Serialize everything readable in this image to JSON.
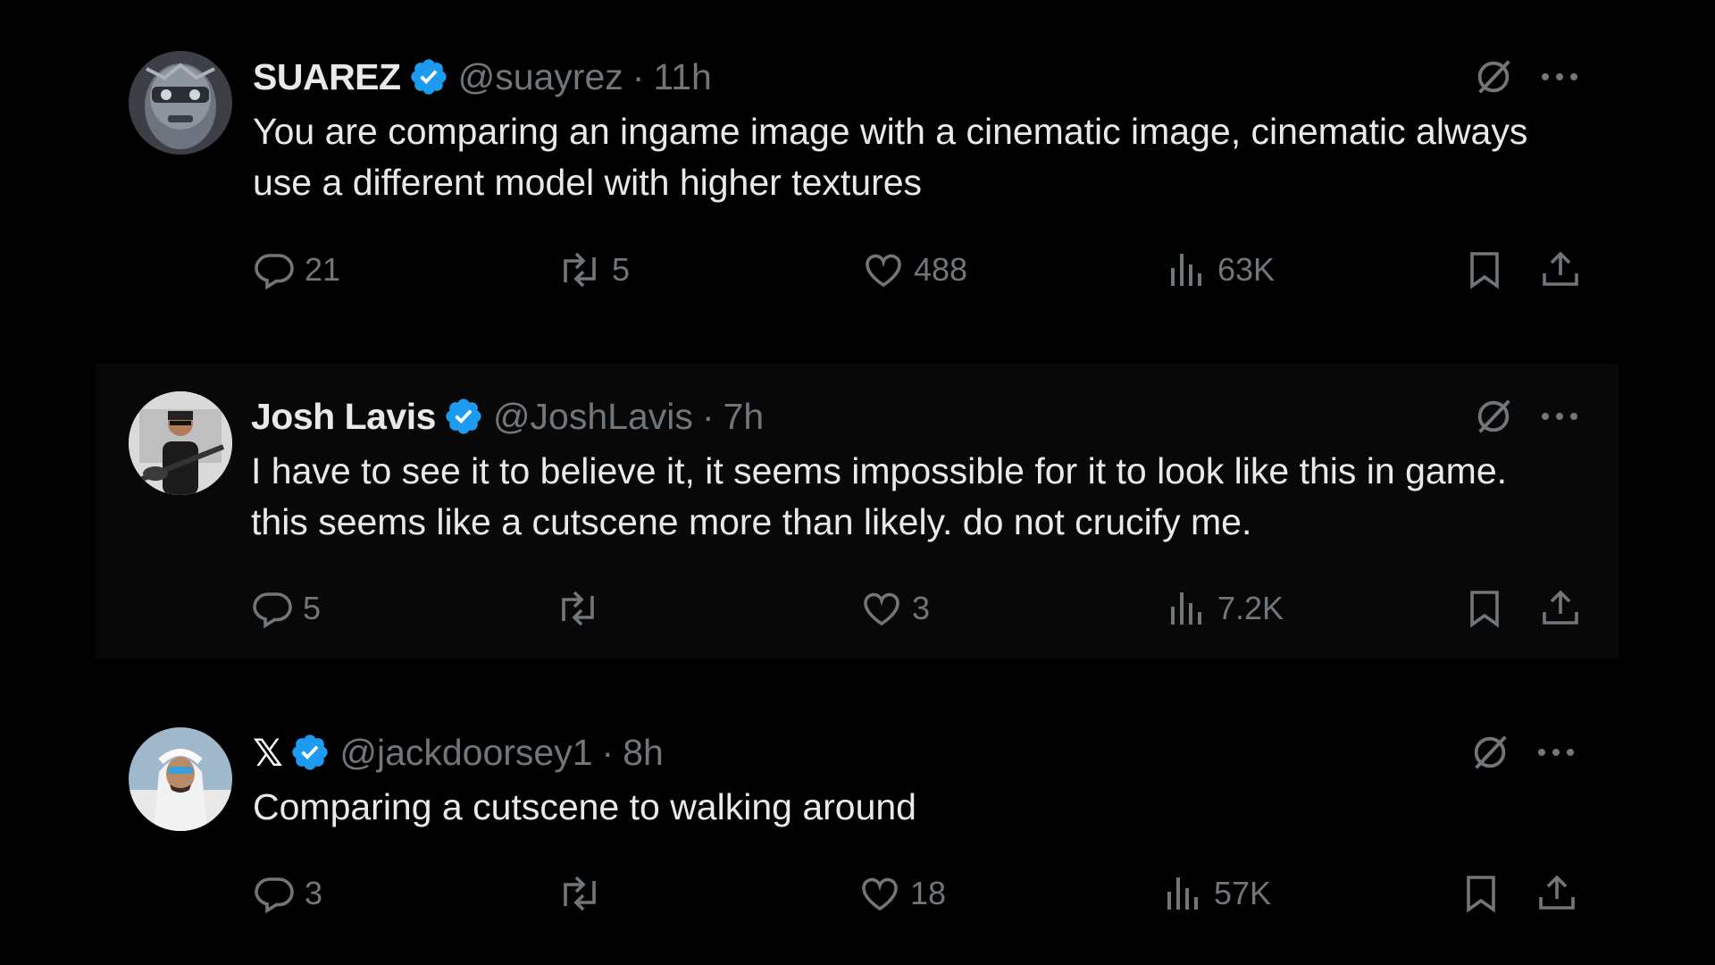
{
  "tweets": [
    {
      "name": "SUAREZ",
      "handle": "@suayrez",
      "time": "11h",
      "text": "You are comparing an ingame image with a cinematic image, cinematic always use a different model with higher textures",
      "replies": "21",
      "reposts": "5",
      "likes": "488",
      "views": "63K"
    },
    {
      "name": "Josh Lavis",
      "handle": "@JoshLavis",
      "time": "7h",
      "text": "I have to see it to believe it, it seems impossible for it to look like this in game. this seems like a cutscene more than likely. do not crucify me.",
      "replies": "5",
      "reposts": "",
      "likes": "3",
      "views": "7.2K"
    },
    {
      "name": "𝕏",
      "handle": "@jackdoorsey1",
      "time": "8h",
      "text": "Comparing a cutscene to walking around",
      "replies": "3",
      "reposts": "",
      "likes": "18",
      "views": "57K"
    }
  ],
  "separator": "·",
  "colors": {
    "background": "#000000",
    "text": "#e7e9ea",
    "secondary": "#71767b",
    "verified": "#1d9bf0",
    "highlight_row": "#080808"
  },
  "icons": [
    "verified-badge-icon",
    "grok-slash-icon",
    "more-dots-icon",
    "reply-icon",
    "repost-icon",
    "like-icon",
    "views-icon",
    "bookmark-icon",
    "share-icon"
  ]
}
